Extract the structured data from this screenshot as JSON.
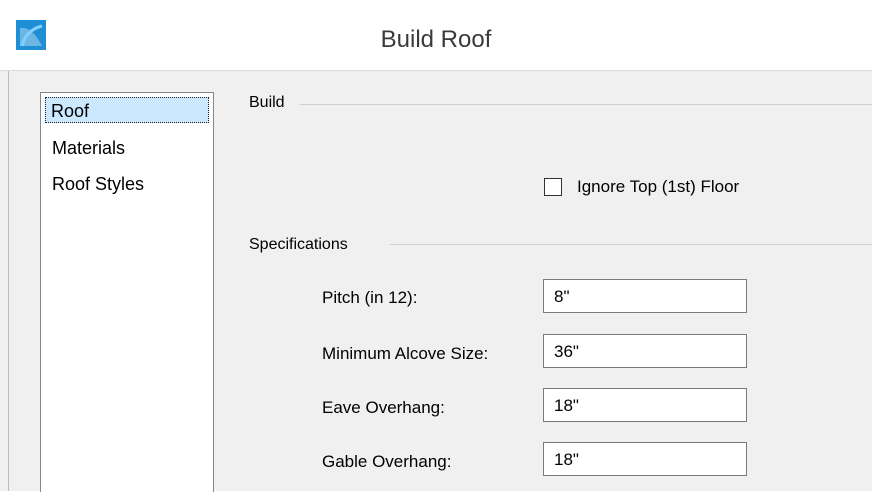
{
  "window": {
    "title": "Build Roof",
    "icon": "app-icon",
    "icon_color": "#1e8fd4"
  },
  "sidebar": {
    "items": [
      {
        "label": "Roof",
        "selected": true
      },
      {
        "label": "Materials",
        "selected": false
      },
      {
        "label": "Roof Styles",
        "selected": false
      }
    ],
    "selection_color": "#cce8ff"
  },
  "build": {
    "group_label": "Build",
    "ignore_top_floor": {
      "label": "Ignore Top (1st) Floor",
      "checked": false
    }
  },
  "specifications": {
    "group_label": "Specifications",
    "fields": [
      {
        "label": "Pitch (in 12):",
        "value": "8\""
      },
      {
        "label": "Minimum Alcove Size:",
        "value": "36\""
      },
      {
        "label": "Eave Overhang:",
        "value": "18\""
      },
      {
        "label": "Gable Overhang:",
        "value": "18\""
      }
    ]
  }
}
